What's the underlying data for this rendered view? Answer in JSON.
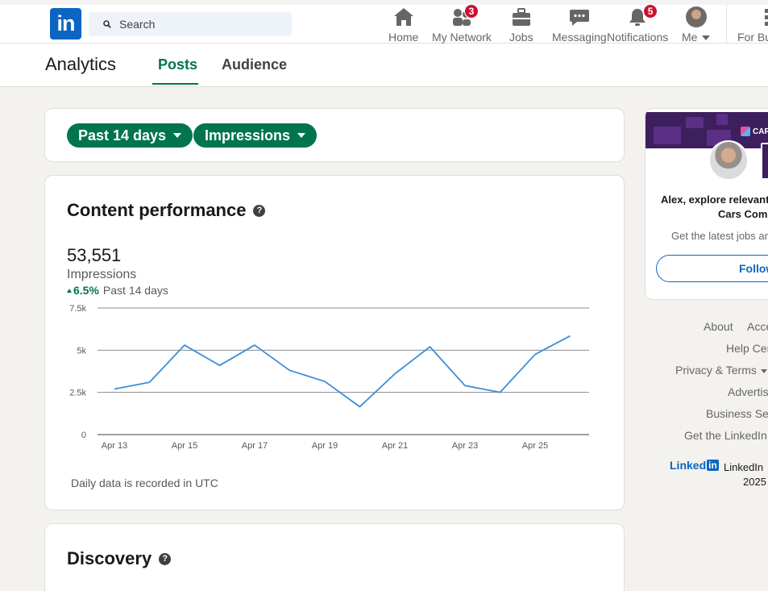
{
  "nav": {
    "search_placeholder": "Search",
    "items": [
      {
        "label": "Home",
        "icon": "home-icon"
      },
      {
        "label": "My Network",
        "icon": "network-icon",
        "badge": "3"
      },
      {
        "label": "Jobs",
        "icon": "briefcase-icon"
      },
      {
        "label": "Messaging",
        "icon": "messaging-icon"
      },
      {
        "label": "Notifications",
        "icon": "bell-icon",
        "badge": "5"
      },
      {
        "label": "Me",
        "icon": "avatar"
      },
      {
        "label": "For Bu",
        "icon": "grid-icon"
      }
    ]
  },
  "subnav": {
    "title": "Analytics",
    "tabs": [
      "Posts",
      "Audience"
    ],
    "active_tab": "Posts"
  },
  "filters": {
    "period": "Past 14 days",
    "metric": "Impressions"
  },
  "performance": {
    "heading": "Content performance",
    "total": "53,551",
    "metric_label": "Impressions",
    "change": "6.5%",
    "change_period": "Past 14 days",
    "footnote": "Daily data is recorded in UTC"
  },
  "discovery": {
    "heading": "Discovery"
  },
  "chart_data": {
    "type": "line",
    "x": [
      "Apr 13",
      "Apr 14",
      "Apr 15",
      "Apr 16",
      "Apr 17",
      "Apr 18",
      "Apr 19",
      "Apr 20",
      "Apr 21",
      "Apr 22",
      "Apr 23",
      "Apr 24",
      "Apr 25",
      "Apr 26"
    ],
    "x_tick_labels": [
      "Apr 13",
      "Apr 15",
      "Apr 17",
      "Apr 19",
      "Apr 21",
      "Apr 23",
      "Apr 25"
    ],
    "y_tick_labels": [
      "0",
      "2.5k",
      "5k",
      "7.5k"
    ],
    "series": [
      {
        "values": [
          2700,
          3100,
          5300,
          4100,
          5300,
          3800,
          3150,
          1650,
          3600,
          5200,
          2900,
          2500,
          4750,
          5850
        ]
      }
    ],
    "ylim": [
      0,
      7500
    ],
    "grid": true,
    "line_color": "#3b8ed8"
  },
  "right_rail": {
    "banner_company": "CAR",
    "promo_line1": "Alex, explore relevant o",
    "promo_line2": "Cars Comm",
    "promo_sub": "Get the latest jobs and",
    "follow_label": "Follow",
    "footer_links": [
      "About",
      "Acce",
      "Help Cen",
      "Privacy & Terms",
      "Advertisi",
      "Business Serv",
      "Get the LinkedIn a"
    ],
    "brand_word": "Linked",
    "brand_in": "in",
    "copyright_prefix": "LinkedIn",
    "copyright_year": "2025"
  },
  "colors": {
    "brand_blue": "#0a66c2",
    "accent_green": "#01754f",
    "badge_red": "#cb112d"
  }
}
